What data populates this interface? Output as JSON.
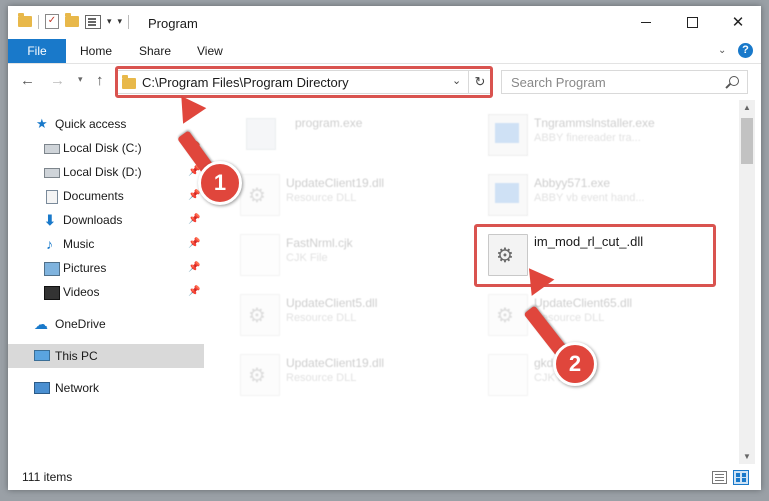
{
  "window": {
    "title": "Program",
    "minimize_glyph": "—",
    "close_glyph": "✕"
  },
  "ribbon": {
    "tabs": [
      "File",
      "Home",
      "Share",
      "View"
    ],
    "help_glyph": "?"
  },
  "navbar": {
    "address": "C:\\Program Files\\Program Directory",
    "search_placeholder": "Search Program"
  },
  "navpane": {
    "items": [
      {
        "label": "Quick access",
        "icon": "star-icon"
      },
      {
        "label": "Local Disk (C:)",
        "icon": "drive-icon",
        "pinned": true
      },
      {
        "label": "Local Disk (D:)",
        "icon": "drive-icon",
        "pinned": true
      },
      {
        "label": "Documents",
        "icon": "documents-icon",
        "pinned": true
      },
      {
        "label": "Downloads",
        "icon": "download-icon",
        "pinned": true
      },
      {
        "label": "Music",
        "icon": "music-icon",
        "pinned": true
      },
      {
        "label": "Pictures",
        "icon": "pictures-icon",
        "pinned": true
      },
      {
        "label": "Videos",
        "icon": "videos-icon",
        "pinned": true
      },
      {
        "label": "OneDrive",
        "icon": "cloud-icon"
      },
      {
        "label": "This PC",
        "icon": "computer-icon",
        "selected": true
      },
      {
        "label": "Network",
        "icon": "network-icon"
      }
    ]
  },
  "files": [
    {
      "name": "program.exe",
      "type": ""
    },
    {
      "name": "Tngrammslnstaller.exe",
      "type": "ABBY finereader tra..."
    },
    {
      "name": "UpdateClient19.dll",
      "type": "Resource DLL"
    },
    {
      "name": "Abbyy571.exe",
      "type": "ABBY vb event hand..."
    },
    {
      "name": "FastNrml.cjk",
      "type": "CJK File"
    },
    {
      "name": "im_mod_rl_cut_.dll",
      "type": ""
    },
    {
      "name": "UpdateClient5.dll",
      "type": "Resource DLL"
    },
    {
      "name": "UpdateClient65.dll",
      "type": "Resource DLL"
    },
    {
      "name": "UpdateClient19.dll",
      "type": "Resource DLL"
    },
    {
      "name": "gkd.cjk",
      "type": "CJK File"
    }
  ],
  "status": {
    "item_count": "111 items"
  },
  "annotations": {
    "step1": "1",
    "step2": "2",
    "color": "#e0463c"
  },
  "colors": {
    "accent": "#1979ca",
    "selection": "#d9d9d9",
    "annotation": "#d9534f"
  }
}
